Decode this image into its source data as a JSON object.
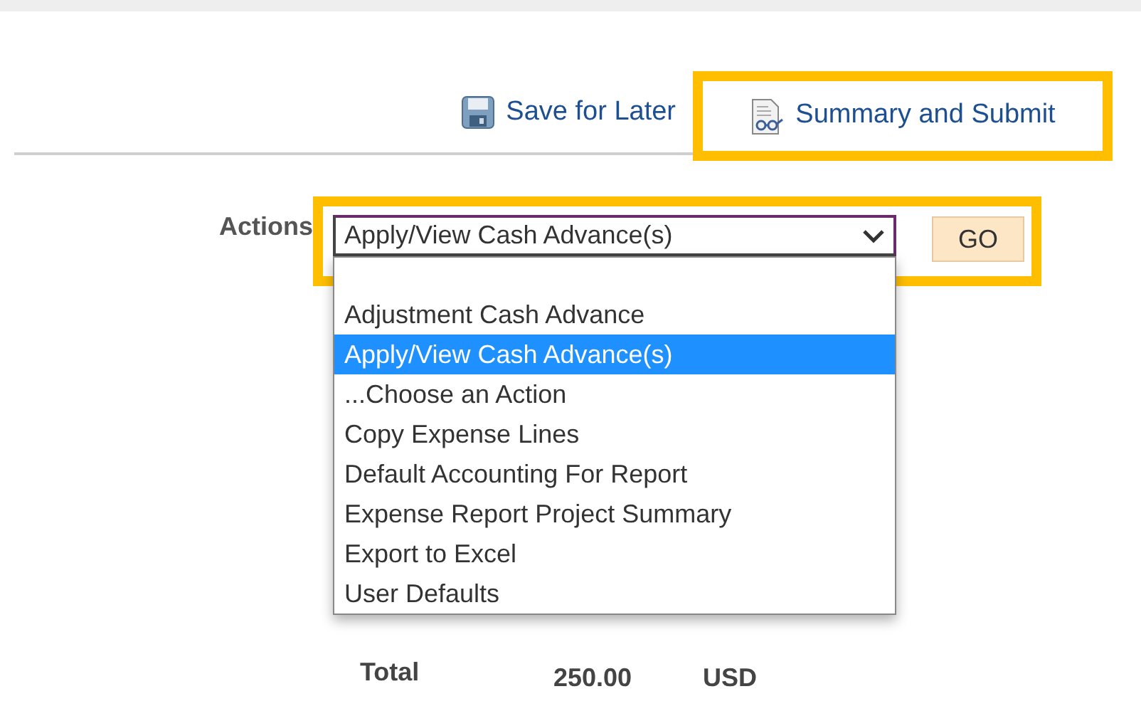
{
  "toolbar": {
    "save_link": {
      "label": "Save for Later",
      "highlighted": false
    },
    "submit_link": {
      "label": "Summary and Submit",
      "highlighted": true
    }
  },
  "actions": {
    "label": "Actions",
    "value": "Apply/View Cash Advance(s)",
    "highlighted": true,
    "expanded": true,
    "go_button": "GO",
    "options": [
      {
        "label": "Adjustment Cash Advance",
        "selected": false
      },
      {
        "label": "Apply/View Cash Advance(s)",
        "selected": true
      },
      {
        "label": "...Choose an Action",
        "selected": false
      },
      {
        "label": "Copy Expense Lines",
        "selected": false
      },
      {
        "label": "Default Accounting For Report",
        "selected": false
      },
      {
        "label": "Expense Report Project Summary",
        "selected": false
      },
      {
        "label": "Export to Excel",
        "selected": false
      },
      {
        "label": "User Defaults",
        "selected": false
      }
    ]
  },
  "total": {
    "label": "Total",
    "amount": "250.00",
    "currency": "USD"
  }
}
